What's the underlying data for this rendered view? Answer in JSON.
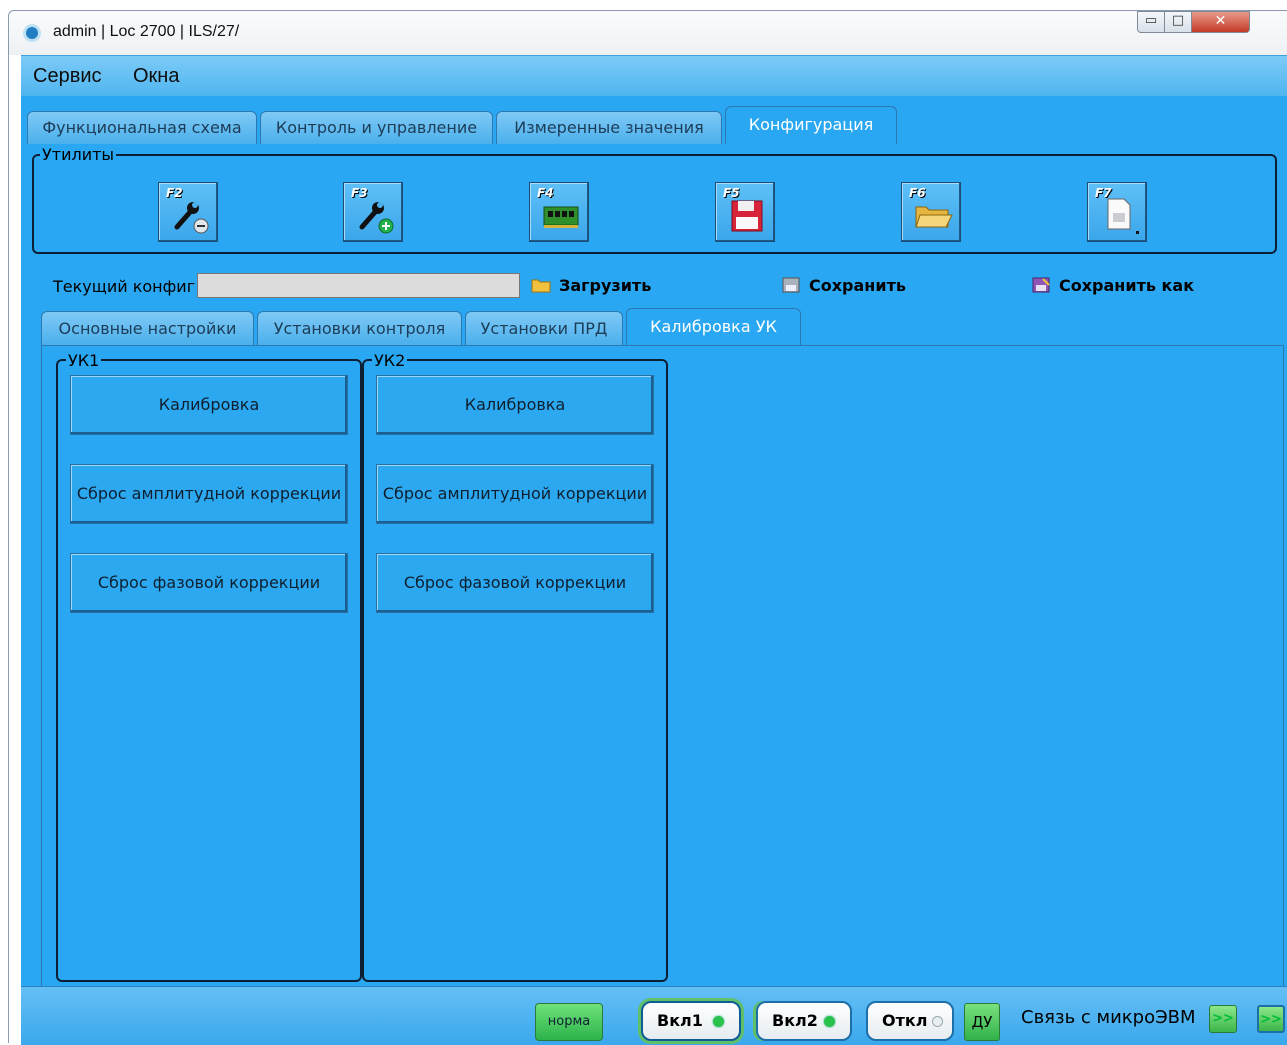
{
  "window": {
    "title": "admin | Loc 2700 | ILS/27/",
    "minimize_glyph": "▭",
    "maximize_glyph": "□",
    "close_glyph": "✕"
  },
  "menu": {
    "items": [
      {
        "label": "Сервис"
      },
      {
        "label": "Окна"
      }
    ]
  },
  "main_tabs": [
    {
      "label": "Функциональная схема",
      "active": false
    },
    {
      "label": "Контроль и управление",
      "active": false
    },
    {
      "label": "Измеренные значения",
      "active": false
    },
    {
      "label": "Конфигурация",
      "active": true
    }
  ],
  "utilities": {
    "legend": "Утилиты",
    "buttons": [
      {
        "key": "F2",
        "icon": "wrench-minus-icon"
      },
      {
        "key": "F3",
        "icon": "wrench-plus-icon"
      },
      {
        "key": "F4",
        "icon": "memory-chip-icon"
      },
      {
        "key": "F5",
        "icon": "floppy-disk-icon"
      },
      {
        "key": "F6",
        "icon": "folder-open-icon"
      },
      {
        "key": "F7",
        "icon": "document-icon"
      }
    ]
  },
  "config": {
    "label": "Текущий конфиг",
    "value": "",
    "load_label": "Загрузить",
    "save_label": "Сохранить",
    "save_as_label": "Сохранить как"
  },
  "sub_tabs": [
    {
      "label": "Основные настройки",
      "active": false
    },
    {
      "label": "Установки контроля",
      "active": false
    },
    {
      "label": "Установки ПРД",
      "active": false
    },
    {
      "label": "Калибровка УК",
      "active": true
    }
  ],
  "groups": [
    {
      "legend": "УК1",
      "buttons": [
        {
          "label": "Калибровка"
        },
        {
          "label": "Сброс амплитудной коррекции"
        },
        {
          "label": "Сброс фазовой коррекции"
        }
      ]
    },
    {
      "legend": "УК2",
      "buttons": [
        {
          "label": "Калибровка"
        },
        {
          "label": "Сброс амплитудной коррекции"
        },
        {
          "label": "Сброс фазовой коррекции"
        }
      ]
    }
  ],
  "status": {
    "norma": "норма",
    "vkl1": "Вкл1",
    "vkl2": "Вкл2",
    "otkl": "Откл",
    "du": "ДУ",
    "link": "Связь с микроЭВМ",
    "arrow1": ">>",
    "arrow2": ">>"
  },
  "colors": {
    "accent": "#29a7f2",
    "tab_inactive": "#4ab0ec",
    "led_on": "#29c24a",
    "status_green": "#32b24a"
  }
}
